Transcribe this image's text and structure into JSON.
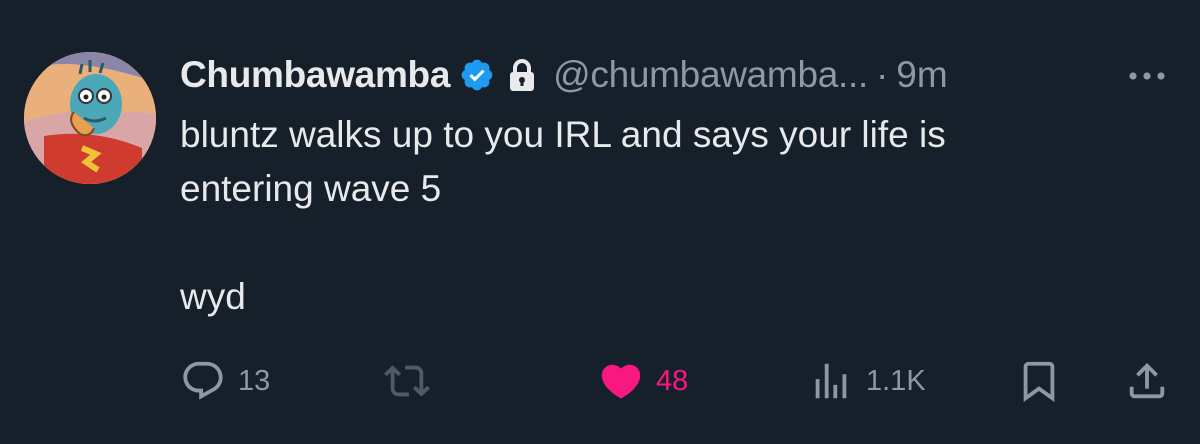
{
  "author": {
    "name": "Chumbawamba",
    "handle": "@chumbawamba...",
    "separator": "·",
    "time": "9m",
    "verified": true,
    "protected": true
  },
  "tweet": {
    "lines": [
      "bluntz walks up to you IRL and says your life is",
      "entering wave 5",
      "wyd"
    ]
  },
  "actions": {
    "replies": "13",
    "reposts": "",
    "likes": "48",
    "liked": true,
    "views": "1.1K"
  },
  "icons": {
    "verified": "verified-badge-icon",
    "protected": "lock-icon",
    "more": "more-dots-icon",
    "reply": "reply-icon",
    "repost": "repost-icon",
    "like": "heart-icon",
    "views": "views-icon",
    "bookmark": "bookmark-icon",
    "share": "share-icon"
  },
  "colors": {
    "background": "#16202a",
    "text": "#e7e9ea",
    "muted": "#8b98a5",
    "verified": "#1d9bf0",
    "like": "#f91880"
  }
}
